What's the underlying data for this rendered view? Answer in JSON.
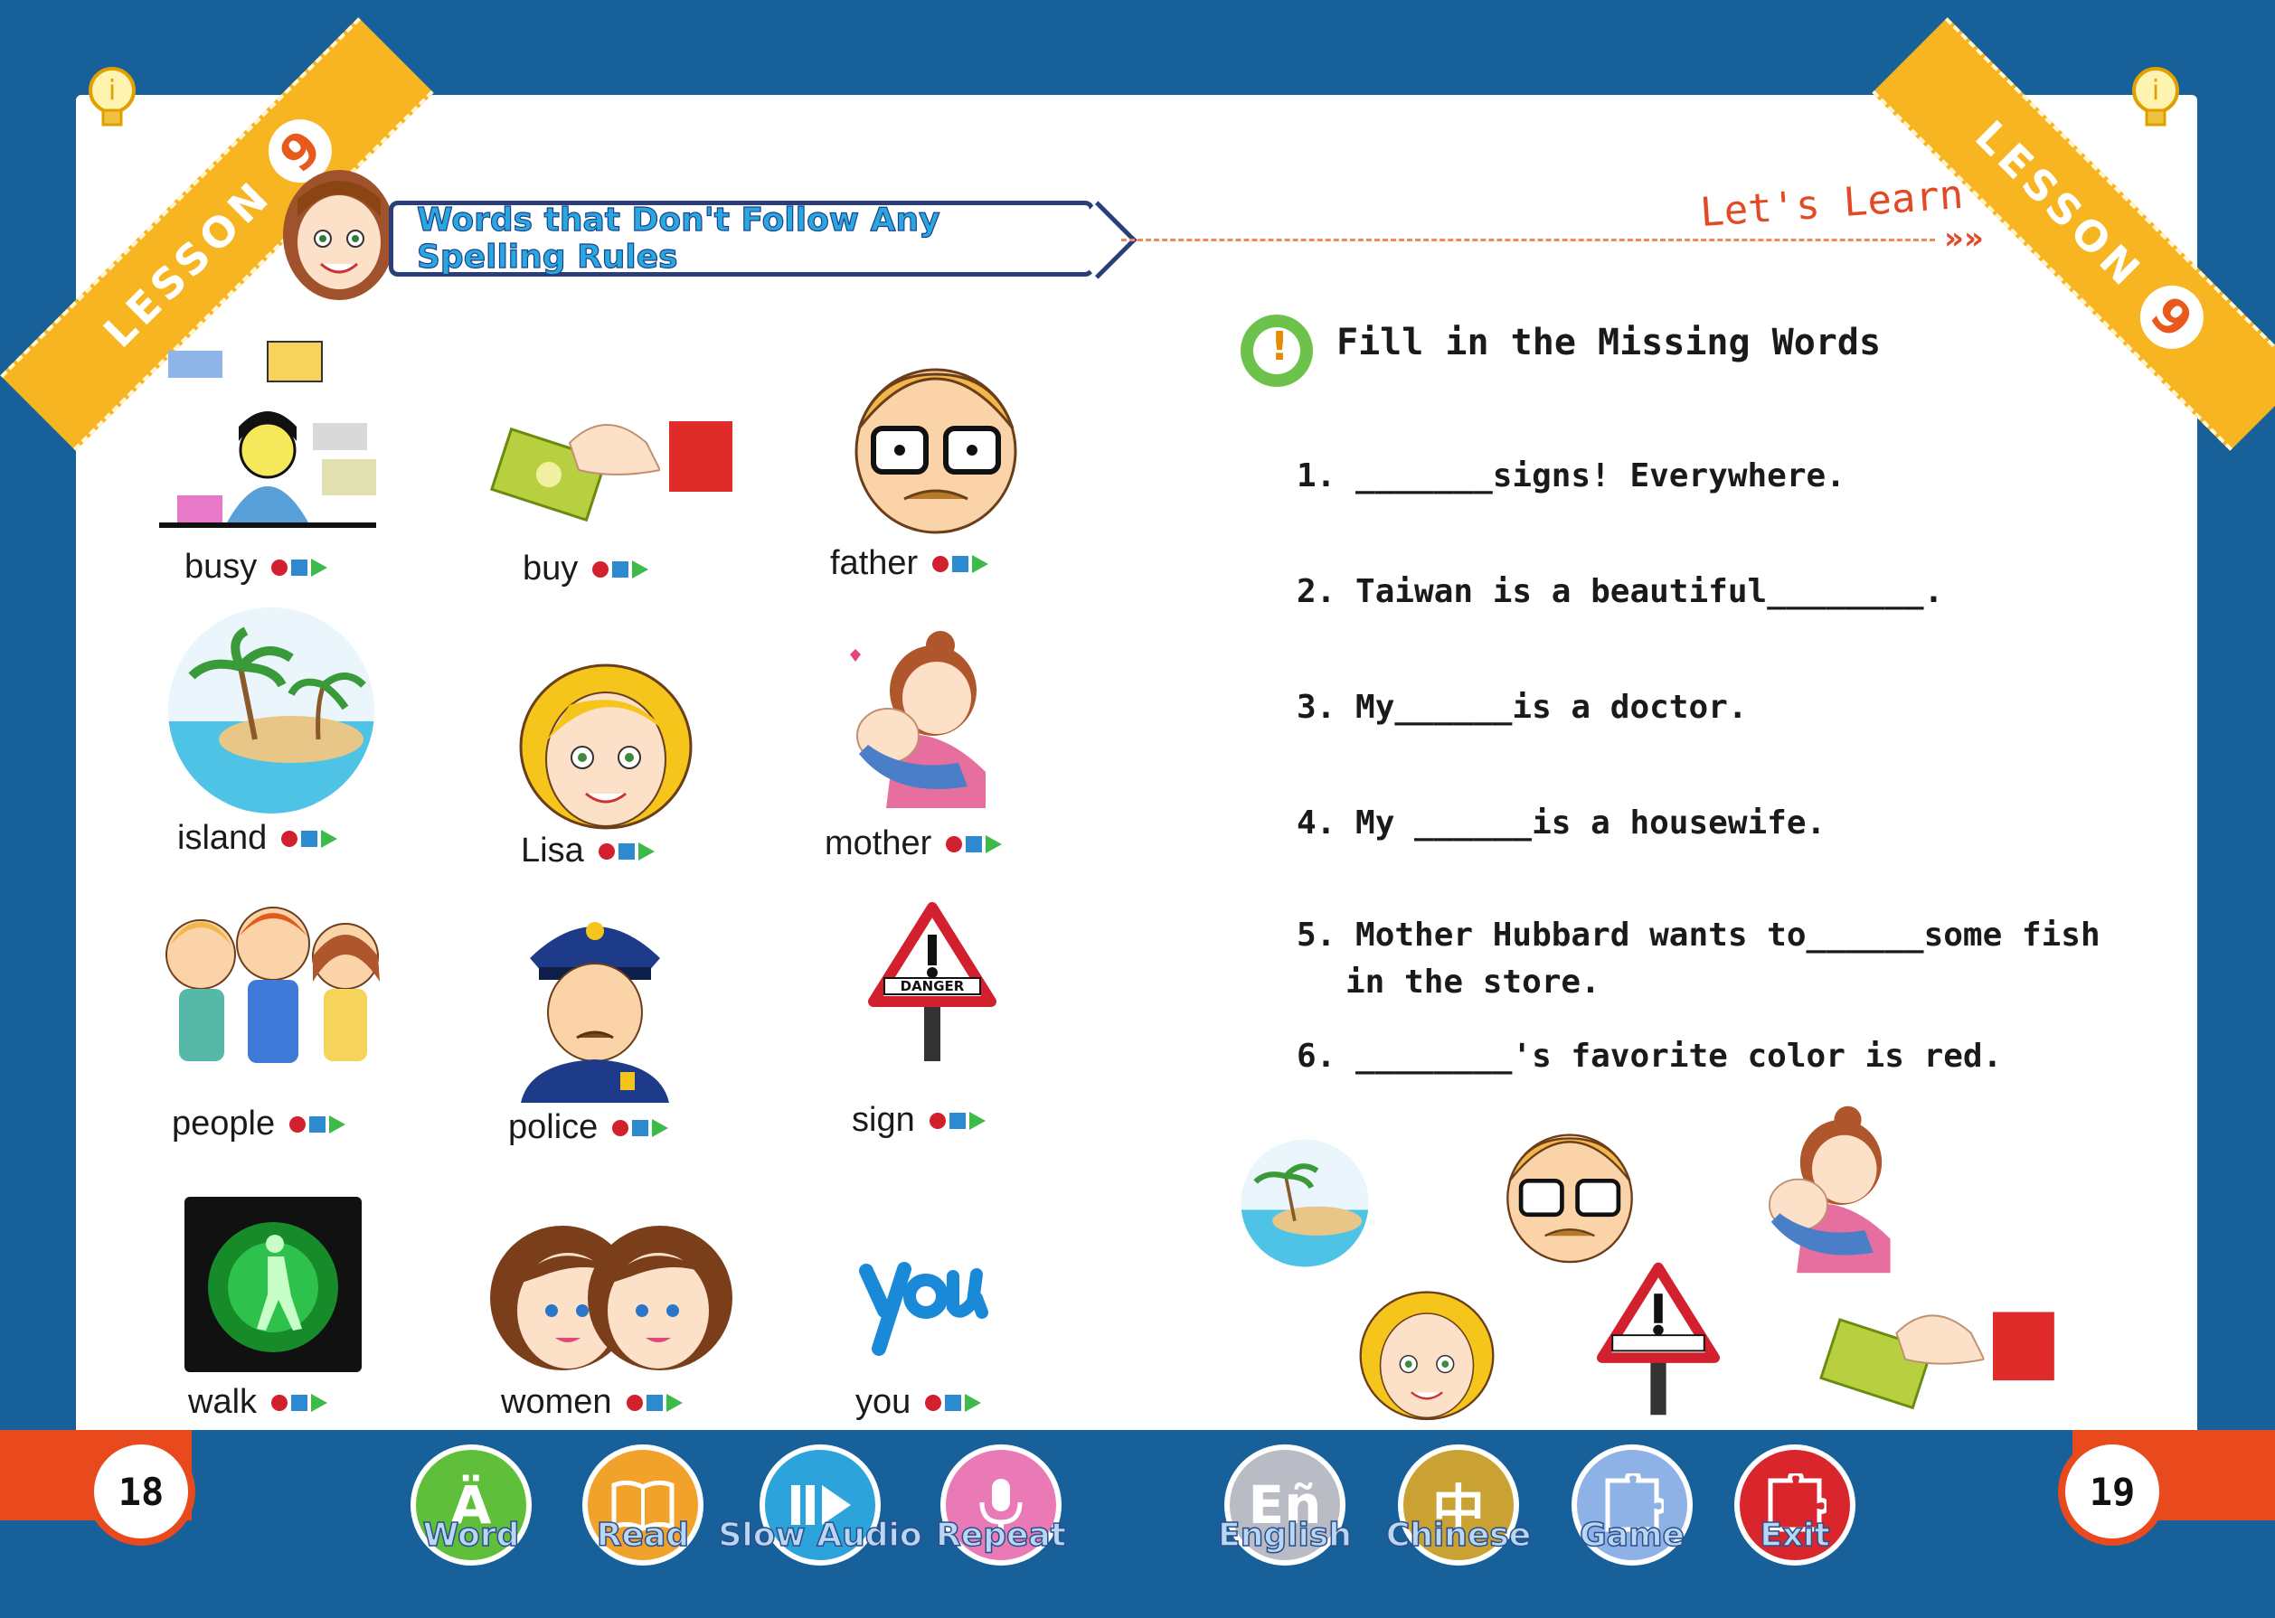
{
  "lesson": {
    "label": "LESSON",
    "number": "9"
  },
  "header": {
    "banner_title": "Words that Don't Follow Any Spelling Rules",
    "section_tag": "Let's Learn",
    "chevrons": "»»"
  },
  "vocabulary": [
    {
      "word": "busy",
      "icon": "busy-woman-picture"
    },
    {
      "word": "buy",
      "icon": "hand-money-picture"
    },
    {
      "word": "father",
      "icon": "father-face-picture"
    },
    {
      "word": "island",
      "icon": "island-picture"
    },
    {
      "word": "Lisa",
      "icon": "lisa-face-picture"
    },
    {
      "word": "mother",
      "icon": "mother-baby-picture"
    },
    {
      "word": "people",
      "icon": "people-group-picture"
    },
    {
      "word": "police",
      "icon": "police-officer-picture"
    },
    {
      "word": "sign",
      "icon": "danger-sign-picture"
    },
    {
      "word": "walk",
      "icon": "walk-signal-picture"
    },
    {
      "word": "women",
      "icon": "two-women-picture"
    },
    {
      "word": "you",
      "icon": "you-text-picture"
    }
  ],
  "exercise": {
    "title": "Fill in the Missing Words",
    "questions": [
      "1. _______signs! Everywhere.",
      "2. Taiwan is a beautiful________.",
      "3.  My______is a doctor.",
      "4. My ______is a housewife.",
      "5. Mother Hubbard wants to______some fish",
      "in the store.",
      "6. ________'s favorite color is red."
    ]
  },
  "pages": {
    "left": "18",
    "right": "19"
  },
  "nav": {
    "word": "Word",
    "read": "Read",
    "slow_audio": "Slow Audio",
    "repeat": "Repeat",
    "english": "English",
    "chinese": "Chinese",
    "chinese_glyph": "中",
    "game": "Game",
    "exit": "Exit",
    "word_glyph": "Ä",
    "english_glyph": "Eñ"
  },
  "colors": {
    "frame_blue": "#17609a",
    "ribbon_gold": "#f6b521",
    "accent_orange": "#e8491d"
  }
}
